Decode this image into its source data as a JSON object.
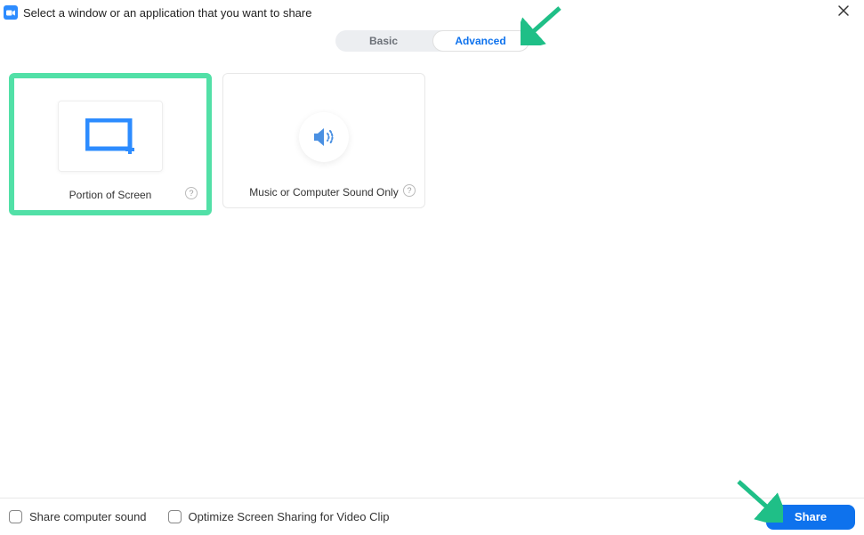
{
  "header": {
    "title": "Select a window or an application that you want to share"
  },
  "tabs": {
    "basic": "Basic",
    "advanced": "Advanced"
  },
  "options": {
    "portion": {
      "label": "Portion of Screen"
    },
    "sound": {
      "label": "Music or Computer Sound Only"
    }
  },
  "footer": {
    "shareSound": "Share computer sound",
    "optimize": "Optimize Screen Sharing for Video Clip",
    "shareBtn": "Share"
  }
}
